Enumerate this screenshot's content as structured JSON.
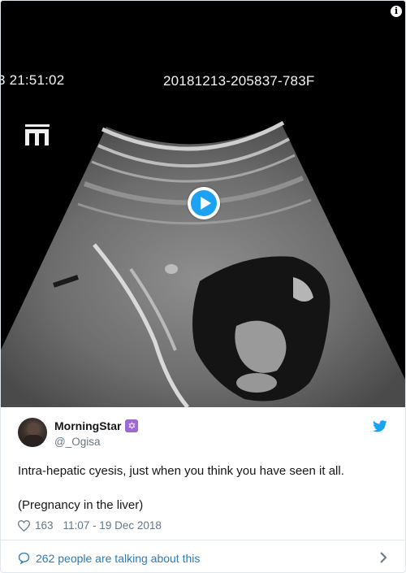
{
  "media": {
    "timestamp_left": "3 21:51:02",
    "timestamp_right": "20181213-205837-783F",
    "logo_text": "m",
    "info_label": "i"
  },
  "tweet": {
    "display_name": "MorningStar",
    "badge_emoji": "✡",
    "handle": "@_Ogisa",
    "text_line1": "Intra-hepatic cyesis, just when you think you have seen it all.",
    "text_line2": "(Pregnancy in the liver)",
    "likes": "163",
    "timestamp": "11:07 - 19 Dec 2018"
  },
  "footer": {
    "talking_text": "262 people are talking about this"
  },
  "colors": {
    "accent": "#1da1f2",
    "link": "#2b7bb9",
    "muted": "#657786"
  },
  "icons": [
    "play-icon",
    "info-icon",
    "twitter-bird-icon",
    "heart-icon",
    "speech-bubble-icon",
    "chevron-right-icon",
    "star-of-david-badge-icon"
  ]
}
